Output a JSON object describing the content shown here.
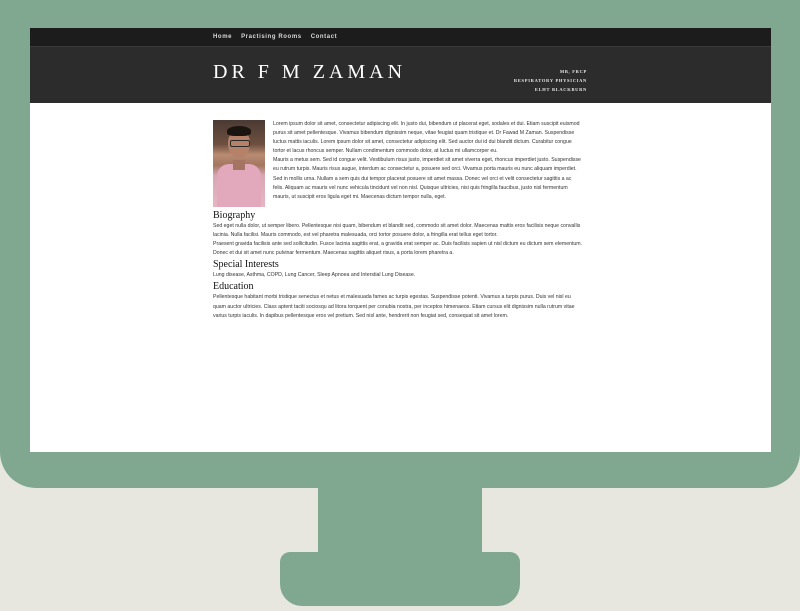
{
  "nav": {
    "items": [
      "Home",
      "Practising Rooms",
      "Contact"
    ]
  },
  "header": {
    "title": "DR F M ZAMAN",
    "credentials": [
      "MB, FRCP",
      "RESPIRATORY PHYSICIAN",
      "ELHT BLACKBURN"
    ]
  },
  "portrait": {
    "alt": "Portrait photo"
  },
  "intro": {
    "p1": "Lorem ipsum dolor sit amet, consectetur adipiscing elit. In justo dui, bibendum ut placerat eget, sodales et dui. Etiam suscipit euismod purus sit amet pellentesque. Vivamus bibendum dignissim neque, vitae feugiat quam tristique et. Dr Fawad M Zaman. Suspendisse luctus mattis iaculis. Lorem ipsum dolor sit amet, consectetur adipiscing elit. Sed auctor dui id dui blandit dictum. Curabitur congue tortor et lacus rhoncus semper. Nullam condimentum commodo dolor, at luctus mi ullamcorper eu.",
    "p2": "Mauris a metus sem. Sed id congue velit. Vestibulum risus justo, imperdiet sit amet viverra eget, rhoncus imperdiet justo. Suspendisse eu rutrum turpis. Mauris risus augue, interdum ac consectetur a, posuere sed orci. Vivamus porta mauris eu nunc aliquam imperdiet. Sed in mollis urna. Nullam a sem quis dui tempor placerat posuere sit amet massa. Donec vel orci et velit consectetur sagittis a ac felis. Aliquam ac mauris vel nunc vehicula tincidunt vel non nisl. Quisque ultricies, nisi quis fringilla faucibus, justo nisl fermentum mauris, ut suscipit eros ligula eget mi. Maecenas dictum tempor nulla, eget."
  },
  "biography": {
    "heading": "Biography",
    "p1": "Sed eget nulla dolor, ut semper libero. Pellentesque nisi quam, bibendum et blandit sed, commodo sit amet dolor. Maecenas mattis eros facilisis neque convallis lacinia. Nulla facilisi. Mauris commodo, est vel pharetra malesuada, orci tortor posuere dolor, a fringilla erat tellus eget tortor.",
    "p2": "Praesent gravida facilisis ante sed sollicitudin. Fusce lacinia sagittis erat, a gravida erat semper ac. Duis facilisis sapien ut nisl dictum eu dictum sem elementum. Donec et dui sit amet nunc pulvinar fermentum. Maecenas sagittis aliquet risus, a porta lorem pharetra a."
  },
  "special_interests": {
    "heading": "Special Interests",
    "text": "Lung disease, Asthma, COPD, Lung Cancer, Sleep Apnoea and Interstial Lung Disease."
  },
  "education": {
    "heading": "Education",
    "text": "Pellentesque habitant morbi tristique senectus et netus et malesuada fames ac turpis egestas. Suspendisse potenti. Vivamus a turpis purus. Duis vel nisl eu quam auctor ultricies. Class aptent taciti sociosqu ad litora torquent per conubia nostra, per inceptos himenaeos. Etiam cursus elit dignissim nulla rutrum vitae varius turpis iaculis. In dapibus pellentesque eros vel pretium. Sed nisl ante, hendrerit non feugiat sed, consequat sit amet lorem."
  }
}
